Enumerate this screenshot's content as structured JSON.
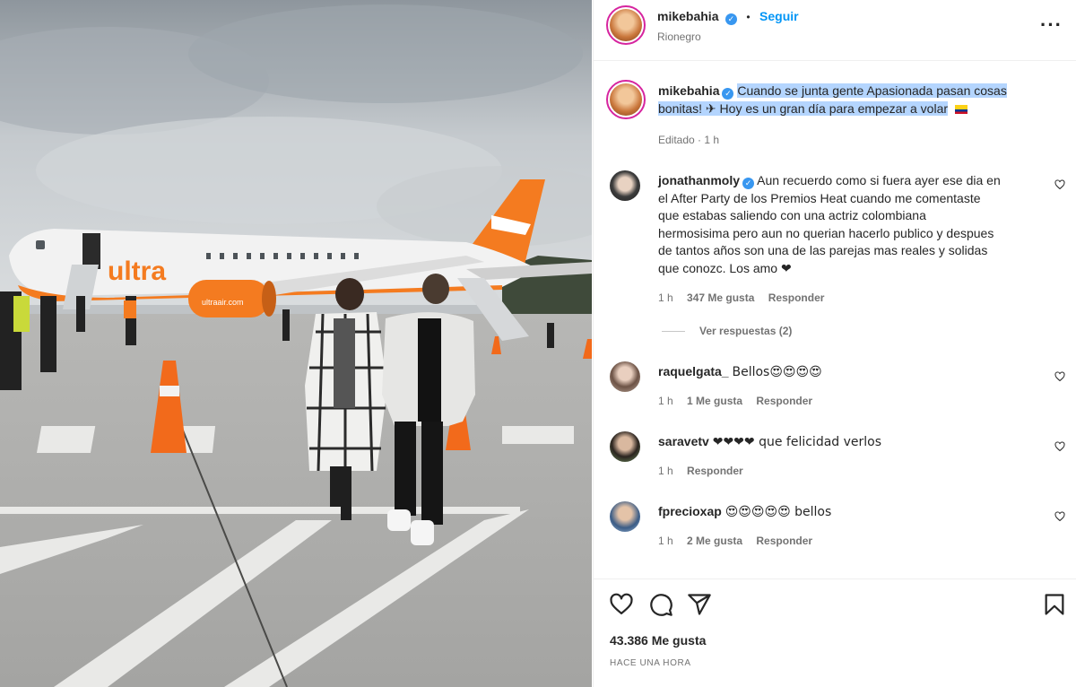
{
  "photo": {
    "airline_logo": "ultra",
    "engine_text": "ultraair.com"
  },
  "header": {
    "username": "mikebahia",
    "dot": "•",
    "follow_label": "Seguir",
    "location": "Rionegro",
    "more_icon": "more-horizontal-icon"
  },
  "caption": {
    "username": "mikebahia",
    "text_line1": "Cuando se junta gente Apasionada pasan cosas",
    "text_line2": "bonitas! ✈ Hoy es un gran día para empezar a volar",
    "meta": "Editado · 1 h"
  },
  "comments": [
    {
      "username": "jonathanmoly",
      "verified": true,
      "lines": [
        "Aun recuerdo como si fuera ayer ese dia en",
        "el After Party de los Premios Heat cuando me comentaste",
        "que estabas saliendo con una actriz colombiana",
        "hermosisima pero aun no querian hacerlo publico y despues",
        "de tantos años son una de las parejas mas reales y solidas",
        "que conozc. Los amo ❤"
      ],
      "time": "1 h",
      "likes": "347 Me gusta",
      "reply": "Responder",
      "view_replies": "Ver respuestas (2)"
    },
    {
      "username": "raquelgata_",
      "text": "Bellos😍😍😍😍",
      "time": "1 h",
      "likes": "1 Me gusta",
      "reply": "Responder"
    },
    {
      "username": "saravetv",
      "text": "❤❤❤❤ que felicidad verlos",
      "time": "1 h",
      "reply": "Responder"
    },
    {
      "username": "fprecioxap",
      "text": "😍😍😍😍😍 bellos",
      "time": "1 h",
      "likes": "2 Me gusta",
      "reply": "Responder"
    }
  ],
  "footer": {
    "likes": "43.386 Me gusta",
    "time": "Hace una hora"
  },
  "colors": {
    "accent": "#0095f6",
    "verified": "#3897f0",
    "plane_orange": "#f47b20",
    "highlight": "#b4d5fe"
  }
}
